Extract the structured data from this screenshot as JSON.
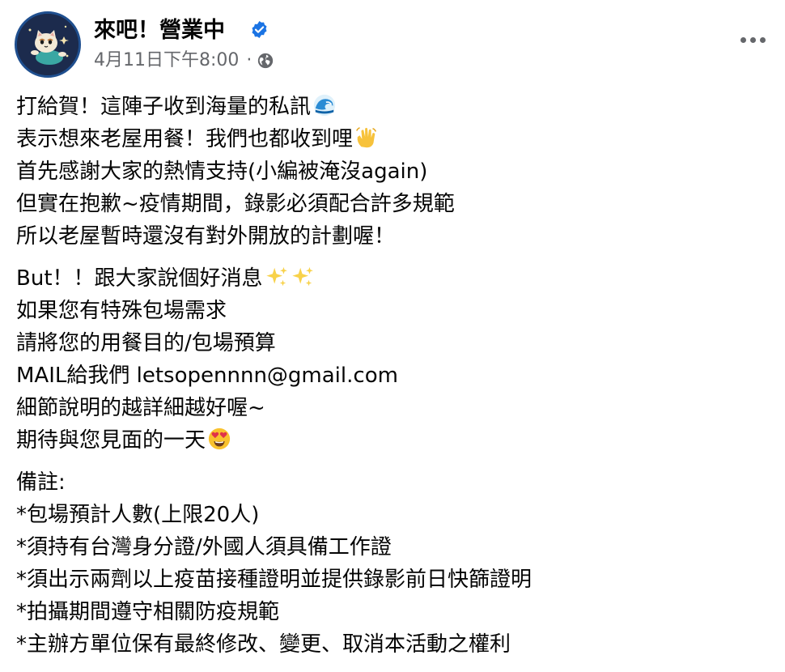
{
  "post": {
    "page_name": "來吧！營業中",
    "timestamp": "4月11日下午8:00",
    "separator": "·",
    "audience_icon": "globe-icon",
    "verified_icon": "verified-badge-icon",
    "more_icon": "more-options-icon"
  },
  "content": {
    "p1": {
      "l1": "打給賀！這陣子收到海量的私訊",
      "l1_emoji": "wave-emoji",
      "l2": "表示想來老屋用餐！我們也都收到哩",
      "l2_emoji": "waving-hand-emoji",
      "l3": "首先感謝大家的熱情支持(小編被淹沒again)",
      "l4": "但實在抱歉~疫情期間，錄影必須配合許多規範",
      "l5": "所以老屋暫時還沒有對外開放的計劃喔！"
    },
    "p2": {
      "l1": "But！！跟大家說個好消息",
      "l1_emoji": "sparkles-emoji",
      "l2": "如果您有特殊包場需求",
      "l3": "請將您的用餐目的/包場預算",
      "l4": "MAIL給我們 letsopennnn@gmail.com",
      "l5": "細節說明的越詳細越好喔~",
      "l6": "期待與您見面的一天",
      "l6_emoji": "heart-eyes-emoji"
    },
    "p3": {
      "l1": "備註:",
      "l2": "*包場預計人數(上限20人)",
      "l3": "*須持有台灣身分證/外國人須具備工作證",
      "l4": "*須出示兩劑以上疫苗接種證明並提供錄影前日快篩證明",
      "l5": "*拍攝期間遵守相關防疫規範",
      "l6": "*主辦方單位保有最終修改、變更、取消本活動之權利"
    }
  },
  "colors": {
    "text": "#050505",
    "meta": "#65676b",
    "verified": "#1b74e4",
    "avatar_ring": "#1f4f8f"
  }
}
